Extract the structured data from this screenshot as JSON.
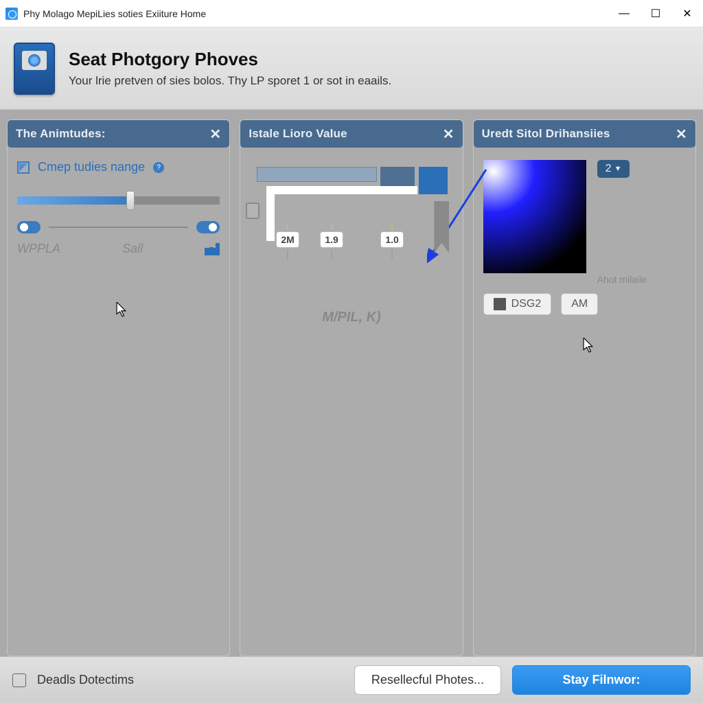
{
  "window": {
    "title": "Phy Molago MepiLies soties Exiiture Home"
  },
  "header": {
    "title": "Seat Photgory Phoves",
    "subtitle": "Your lrie pretven of sies bolos. Thy LP sporet 1 or sot in eaails."
  },
  "panels": {
    "p1": {
      "title": "The Animtudes:",
      "checkbox_label": "Cmep tudies nange",
      "left_label": "WPPLA",
      "right_label": "Sall"
    },
    "p2": {
      "title": "Istale Lioro Value",
      "markers": [
        "2M",
        "1.9",
        "1.0"
      ],
      "axis_label": "M/PIL, K)"
    },
    "p3": {
      "title": "Uredt Sitol Drihansiies",
      "preset_value": "2",
      "aux_label": "Ahot milaile",
      "chip1": "DSG2",
      "chip2": "AM"
    }
  },
  "footer": {
    "checkbox_label": "Deadls Dotectims",
    "secondary_btn": "Resellecful Photes...",
    "primary_btn": "Stay Filnwor:"
  }
}
